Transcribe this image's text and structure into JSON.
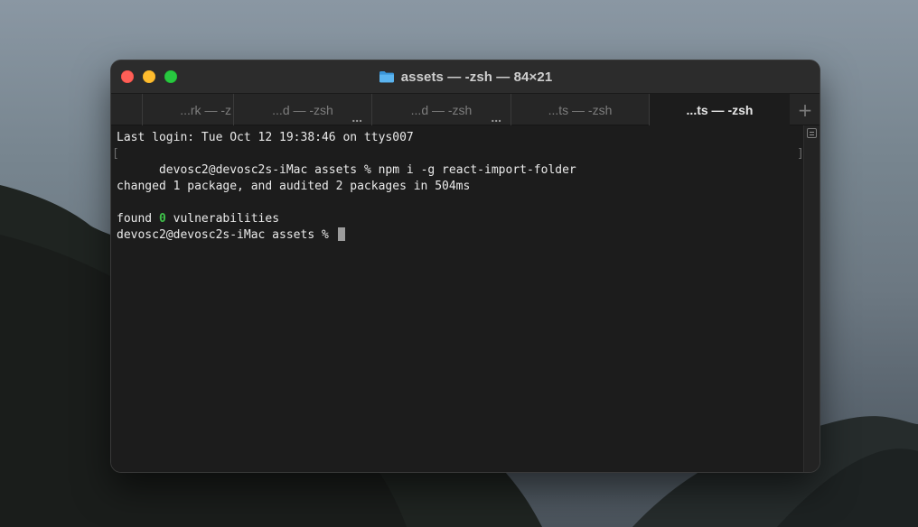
{
  "window": {
    "title": "assets — -zsh — 84×21"
  },
  "tabs": [
    {
      "label": "...rk — -z",
      "active": false
    },
    {
      "label": "...d — -zsh",
      "active": false,
      "more": "..."
    },
    {
      "label": "...d — -zsh",
      "active": false,
      "more": "..."
    },
    {
      "label": "...ts — -zsh",
      "active": false
    },
    {
      "label": "...ts — -zsh",
      "active": true
    }
  ],
  "tab_add_label": "+",
  "terminal": {
    "login_line": "Last login: Tue Oct 12 19:38:46 on ttys007",
    "prompt": "devosc2@devosc2s-iMac assets % ",
    "command": "npm i -g react-import-folder",
    "output_changed": "changed 1 package, and audited 2 packages in 504ms",
    "found_prefix": "found ",
    "vulnerability_count": "0",
    "found_suffix": " vulnerabilities",
    "prompt_final": "devosc2@devosc2s-iMac assets % ",
    "bracket_open": "[",
    "bracket_close": "]"
  },
  "colors": {
    "close": "#fe5f57",
    "minimize": "#febc2e",
    "zoom": "#28c840",
    "vulnerabilities_zero": "#3fc24a",
    "folder_icon": "#4aa8e8"
  },
  "icons": {
    "title": "folder-icon",
    "scroll": "scroll-menu-icon"
  }
}
